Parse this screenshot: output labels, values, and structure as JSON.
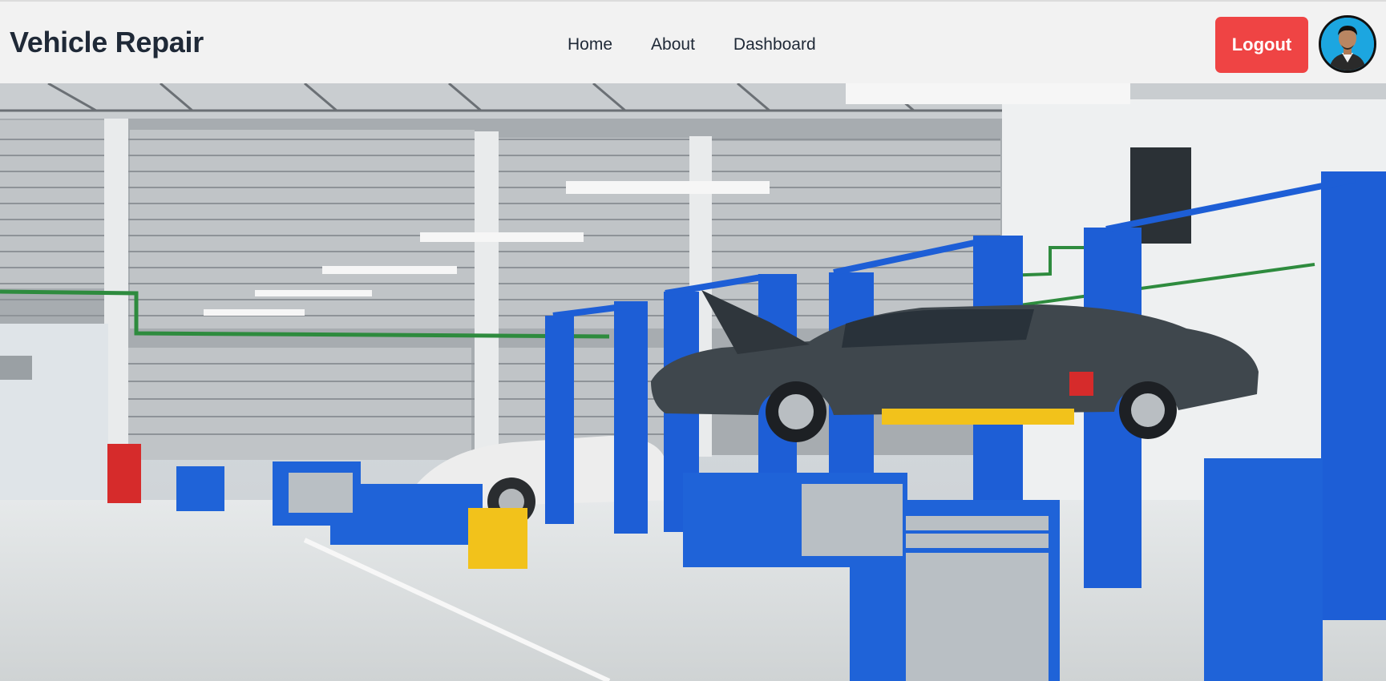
{
  "header": {
    "brand": "Vehicle Repair",
    "nav": [
      {
        "label": "Home"
      },
      {
        "label": "About"
      },
      {
        "label": "Dashboard"
      }
    ],
    "logout_label": "Logout",
    "avatar_icon": "user-avatar-photo"
  },
  "colors": {
    "logout_button": "#ef4444",
    "navbar_bg": "#f2f2f2",
    "lift_blue": "#1d5ed6",
    "avatar_bg": "#1ca6e0"
  },
  "hero": {
    "image_icon": "repair-garage-photo"
  }
}
